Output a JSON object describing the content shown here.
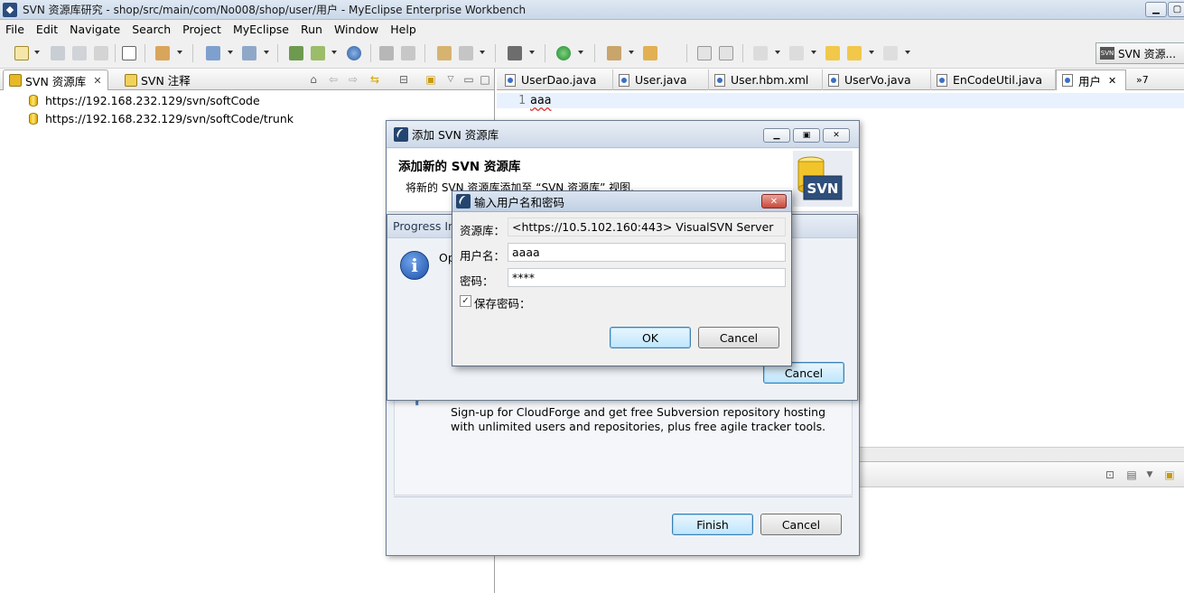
{
  "window": {
    "title": "SVN 资源库研究 - shop/src/main/com/No008/shop/user/用户 - MyEclipse Enterprise Workbench"
  },
  "menu": [
    "File",
    "Edit",
    "Navigate",
    "Search",
    "Project",
    "MyEclipse",
    "Run",
    "Window",
    "Help"
  ],
  "perspective": {
    "label": "SVN 资源..."
  },
  "left_panel": {
    "tabs": [
      {
        "label": "SVN 资源库",
        "active": true
      },
      {
        "label": "SVN 注释",
        "active": false
      }
    ],
    "repositories": [
      "https://192.168.232.129/svn/softCode",
      "https://192.168.232.129/svn/softCode/trunk"
    ]
  },
  "editor": {
    "tabs": [
      {
        "label": "UserDao.java"
      },
      {
        "label": "User.java"
      },
      {
        "label": "User.hbm.xml"
      },
      {
        "label": "UserVo.java"
      },
      {
        "label": "EnCodeUtil.java"
      },
      {
        "label": "用户",
        "active": true
      }
    ],
    "overflow_count": "»7",
    "line_number": "1",
    "code": "aaa"
  },
  "add_repo_dialog": {
    "title": "添加 SVN 资源库",
    "heading": "添加新的 SVN 资源库",
    "description": "将新的 SVN 资源库添加至 “SVN 资源库” 视图.",
    "banner_label": "SVN",
    "cloudforge_text": [
      "Sign-up for CloudForge and get free Subversion repository hosting",
      "with unlimited users and repositories, plus free agile tracker tools."
    ],
    "finish_label": "Finish",
    "cancel_label": "Cancel"
  },
  "progress_dialog": {
    "title": "Progress In",
    "message": "Op",
    "cancel_label": "Cancel"
  },
  "auth_dialog": {
    "title": "输入用户名和密码",
    "repo_label": "资源库：",
    "repo_value": "<https://10.5.102.160:443> VisualSVN Server",
    "user_label": "用户名：",
    "user_value": "aaaa",
    "password_label": "密码：",
    "password_value": "****",
    "save_password_label": "保存密码：",
    "save_password_checked": true,
    "ok_label": "OK",
    "cancel_label": "Cancel"
  }
}
